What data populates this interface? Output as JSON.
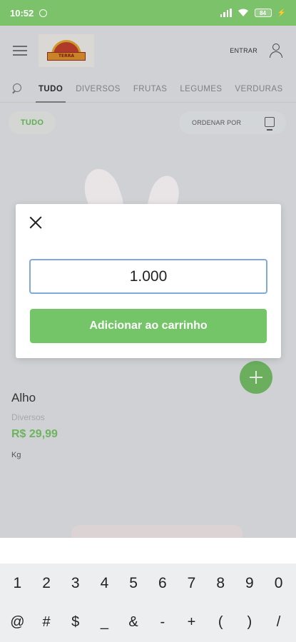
{
  "status": {
    "time": "10:52",
    "battery": "84"
  },
  "header": {
    "login_label": "ENTRAR",
    "logo_text": "TERRA"
  },
  "tabs": [
    {
      "label": "TUDO",
      "active": true
    },
    {
      "label": "DIVERSOS"
    },
    {
      "label": "FRUTAS"
    },
    {
      "label": "LEGUMES"
    },
    {
      "label": "VERDURAS"
    }
  ],
  "filter": {
    "chip_label": "TUDO",
    "sort_label": "ORDENAR POR"
  },
  "product": {
    "name": "Alho",
    "category": "Diversos",
    "price": "R$ 29,99",
    "unit": "Kg"
  },
  "modal": {
    "quantity_value": "1.000",
    "add_button_label": "Adicionar ao carrinho"
  },
  "keyboard": {
    "row1": [
      "1",
      "2",
      "3",
      "4",
      "5",
      "6",
      "7",
      "8",
      "9",
      "0"
    ],
    "row2": [
      "@",
      "#",
      "$",
      "_",
      "&",
      "-",
      "+",
      "(",
      ")",
      "/"
    ]
  },
  "colors": {
    "accent": "#74c567",
    "status_bar": "#7bc26a",
    "price": "#6db45e"
  }
}
